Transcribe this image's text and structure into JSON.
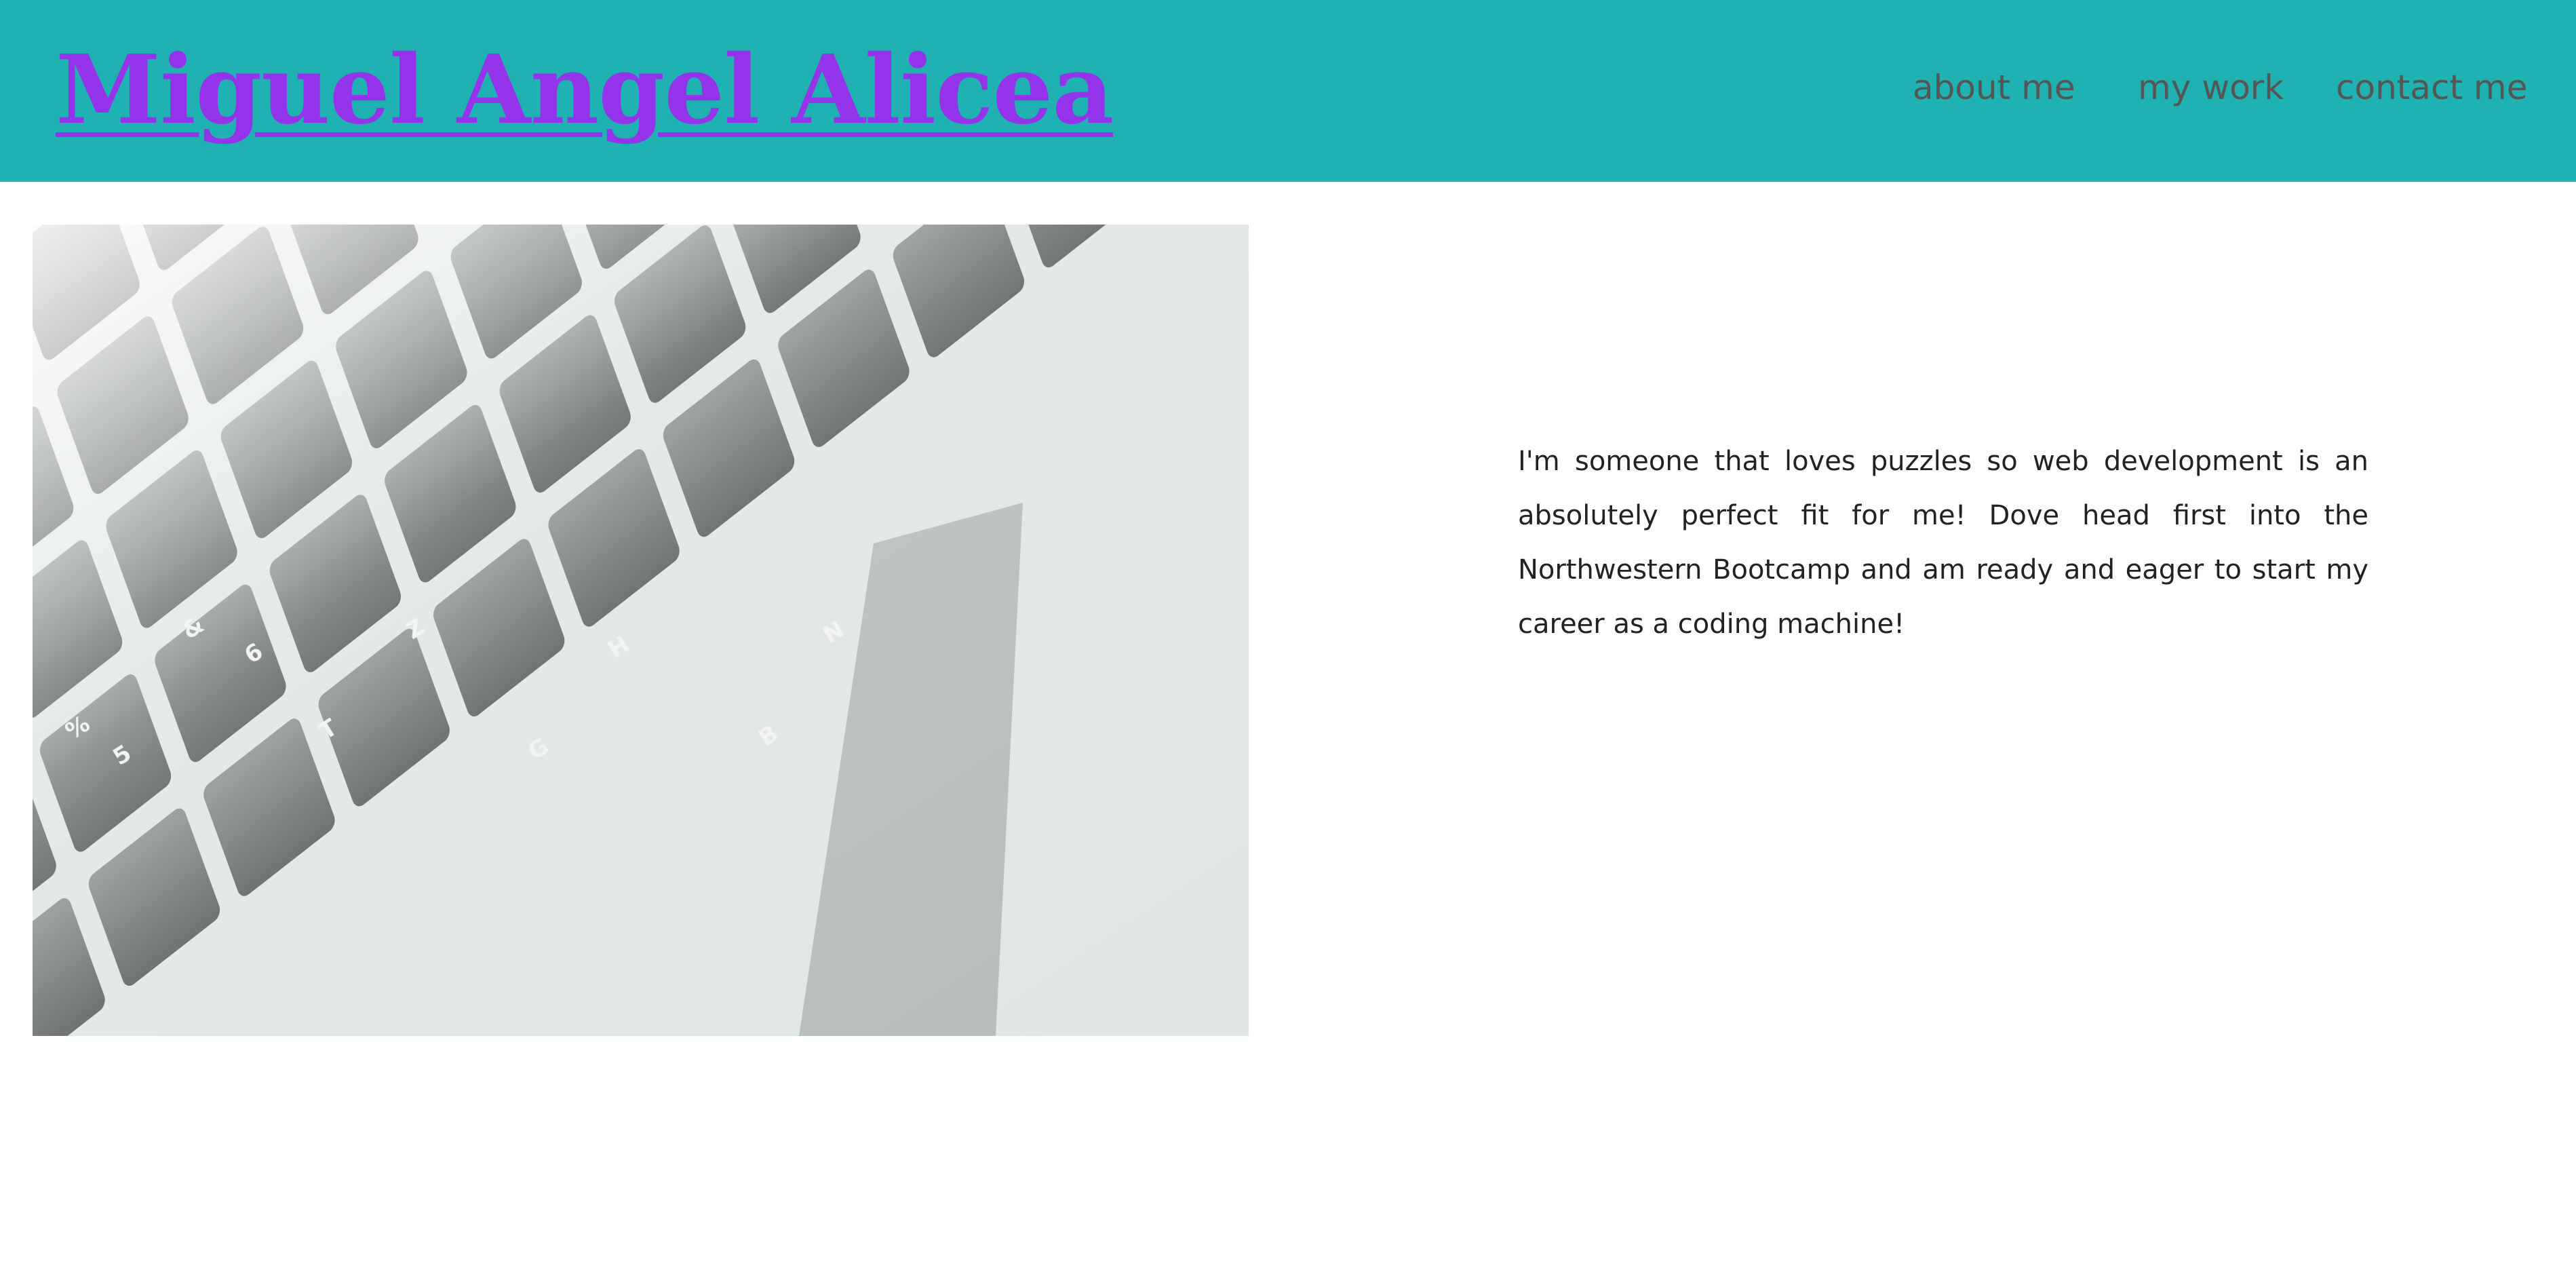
{
  "header": {
    "title": "Miguel Angel Alicea",
    "nav": {
      "about": "about me",
      "work": "my work",
      "contact": "contact me"
    }
  },
  "hero": {
    "image": "laptop-keyboard",
    "keys": [
      "%",
      "5",
      "T",
      "G",
      "B",
      "&",
      "6",
      "Z",
      "H",
      "N"
    ]
  },
  "intro": {
    "text": "I'm someone that loves puzzles so web development is an absolutely perfect fit for me! Dove head first into the Northwestern Bootcamp and am ready and eager to start my career as a coding machine!"
  },
  "colors": {
    "header_bg": "#20b2b2",
    "title": "#9333ea",
    "nav_text": "#555555",
    "body_text": "#222222"
  }
}
